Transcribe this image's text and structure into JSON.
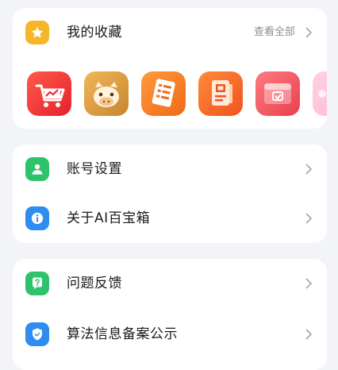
{
  "favorites": {
    "title": "我的收藏",
    "view_all": "查看全部",
    "apps": [
      {
        "icon": "shopping-cart-chart-icon"
      },
      {
        "icon": "cartoon-cow-icon"
      },
      {
        "icon": "notebook-list-icon"
      },
      {
        "icon": "document-badge-icon"
      },
      {
        "icon": "photo-card-icon"
      },
      {
        "icon": "partial-app-icon"
      }
    ]
  },
  "account_section": {
    "items": [
      {
        "label": "账号设置",
        "icon": "person-icon",
        "color": "#2ec26b"
      },
      {
        "label": "关于AI百宝箱",
        "icon": "info-icon",
        "color": "#2f8cf0"
      }
    ]
  },
  "help_section": {
    "items": [
      {
        "label": "问题反馈",
        "icon": "question-icon",
        "color": "#2ec26b"
      },
      {
        "label": "算法信息备案公示",
        "icon": "shield-icon",
        "color": "#2f8cf0"
      }
    ]
  },
  "colors": {
    "favorites_badge": "#f7b52c",
    "background": "#f2f4f7",
    "chevron": "#a6aab0"
  }
}
